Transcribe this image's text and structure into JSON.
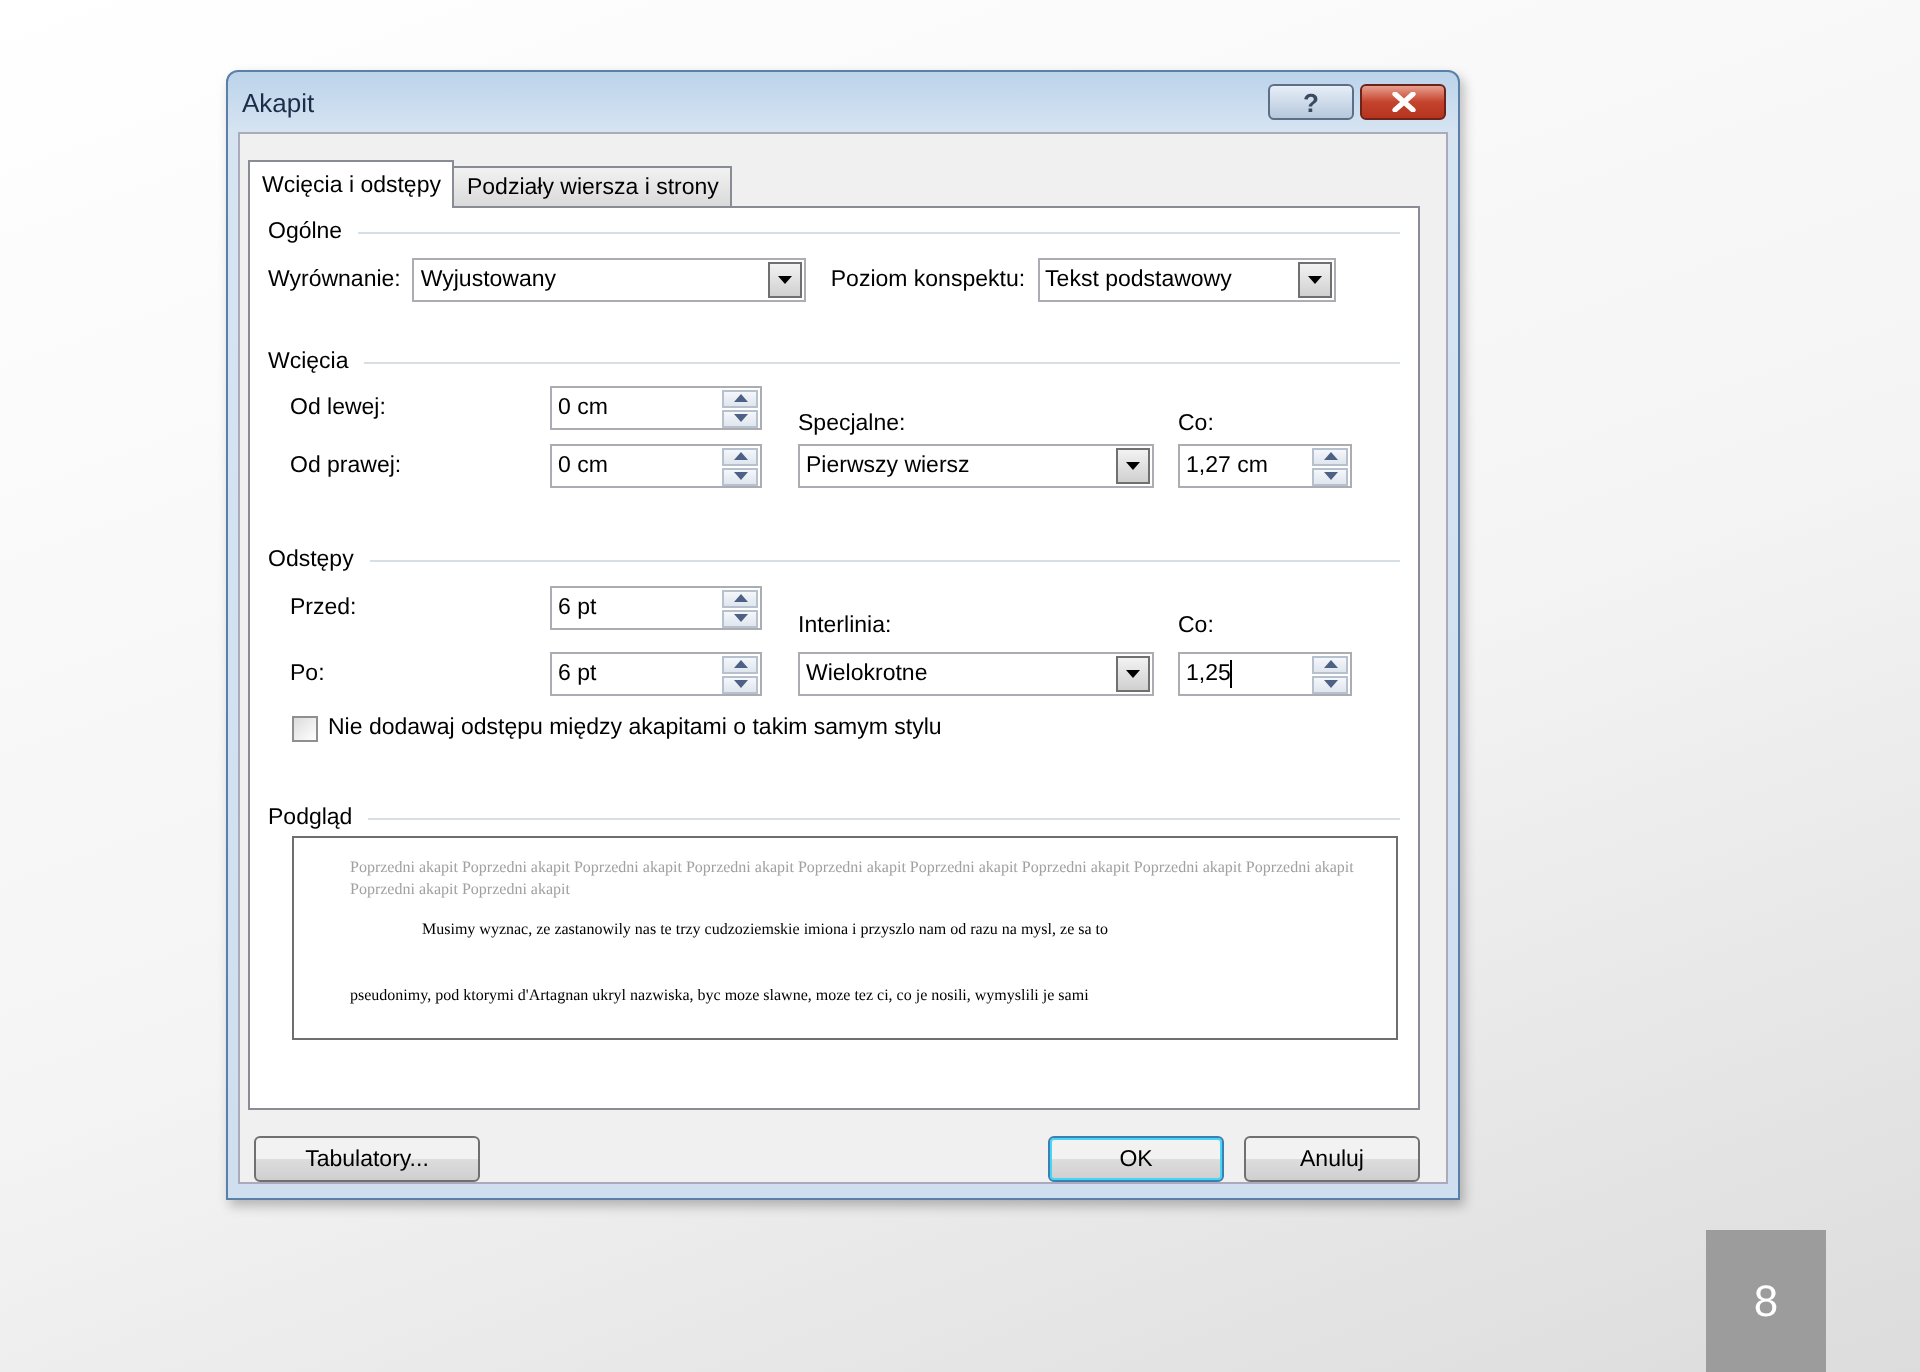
{
  "window": {
    "title": "Akapit",
    "help_button": "?"
  },
  "tabs": [
    {
      "label": "Wcięcia i odstępy",
      "selected": true
    },
    {
      "label": "Podziały wiersza i strony",
      "selected": false
    }
  ],
  "general": {
    "heading": "Ogólne",
    "alignment": {
      "label": "Wyrównanie:",
      "value": "Wyjustowany"
    },
    "outline_level": {
      "label": "Poziom konspektu:",
      "value": "Tekst podstawowy"
    }
  },
  "indentation": {
    "heading": "Wcięcia",
    "left": {
      "label": "Od lewej:",
      "value": "0 cm"
    },
    "right": {
      "label": "Od prawej:",
      "value": "0 cm"
    },
    "special": {
      "label": "Specjalne:",
      "value": "Pierwszy wiersz"
    },
    "by": {
      "label": "Co:",
      "value": "1,27 cm",
      "focused": false
    }
  },
  "spacing": {
    "heading": "Odstępy",
    "before": {
      "label": "Przed:",
      "value": "6 pt"
    },
    "after": {
      "label": "Po:",
      "value": "6 pt"
    },
    "line_spacing": {
      "label": "Interlinia:",
      "value": "Wielokrotne"
    },
    "at": {
      "label": "Co:",
      "value": "1,25",
      "focused": true
    },
    "no_space_checkbox": {
      "label": "Nie dodawaj odstępu między akapitami o takim samym stylu",
      "checked": false
    }
  },
  "preview": {
    "heading": "Podgląd",
    "previous_paragraph": "Poprzedni akapit Poprzedni akapit Poprzedni akapit Poprzedni akapit Poprzedni akapit Poprzedni akapit Poprzedni akapit Poprzedni akapit Poprzedni akapit Poprzedni akapit Poprzedni akapit",
    "sample_lines": [
      "Musimy wyznac, ze zastanowily nas te trzy cudzoziemskie imiona i przyszlo nam od razu na mysl, ze sa to",
      "pseudonimy, pod ktorymi d'Artagnan ukryl nazwiska, byc moze slawne, moze tez ci, co je nosili, wymyslili je sami"
    ]
  },
  "buttons": [
    {
      "label": "Tabulatory...",
      "default": false
    },
    {
      "label": "OK",
      "default": true
    },
    {
      "label": "Anuluj",
      "default": false
    }
  ],
  "slide_number": "8"
}
